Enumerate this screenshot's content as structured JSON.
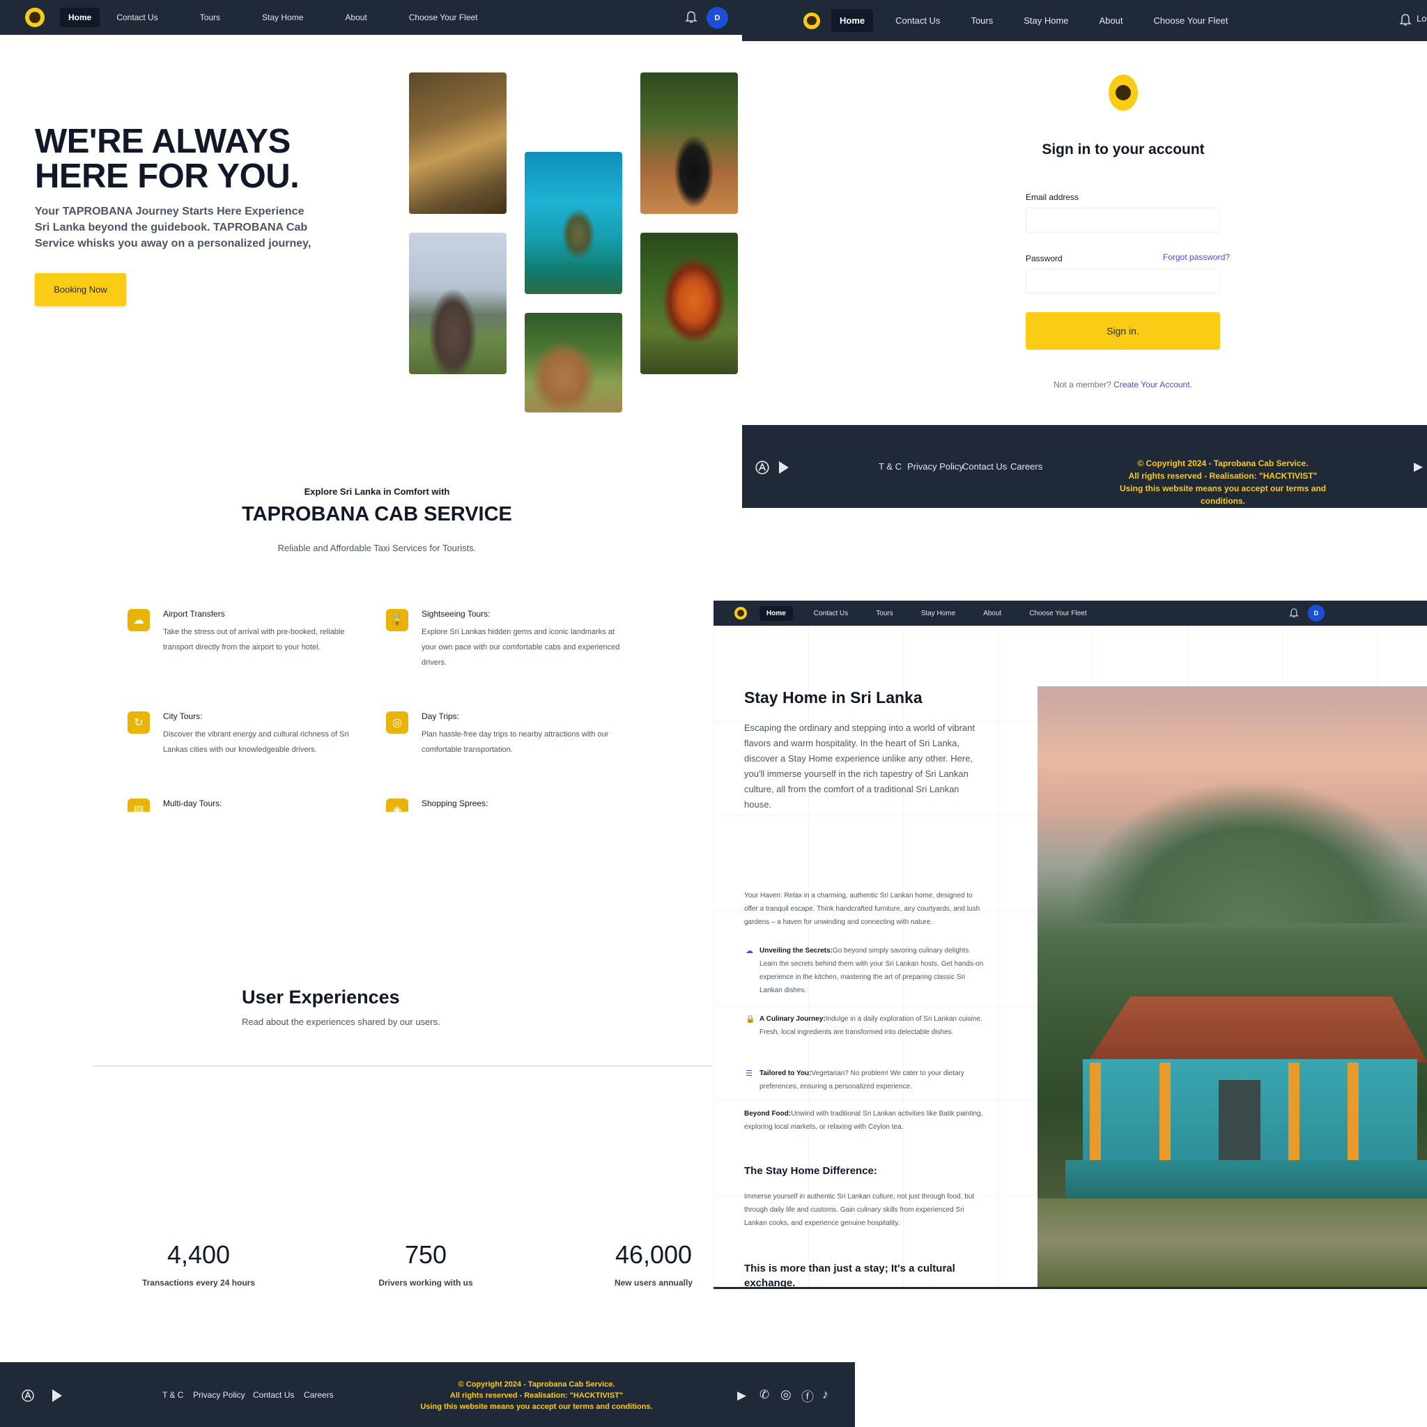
{
  "nav": {
    "items": [
      "Home",
      "Contact Us",
      "Tours",
      "Stay Home",
      "About",
      "Choose Your Fleet"
    ],
    "avatar_letter": "D",
    "login_partial": "Lo"
  },
  "home": {
    "hero_title": "WE'RE ALWAYS HERE FOR YOU.",
    "hero_text": "Your TAPROBANA Journey Starts Here Experience Sri Lanka beyond the guidebook. TAPROBANA Cab Service whisks you away on a personalized journey,",
    "booking_button": "Booking Now",
    "explore_sub": "Explore Sri Lanka in Comfort with",
    "explore_title": "TAPROBANA CAB SERVICE",
    "explore_desc": "Reliable and Affordable Taxi Services for Tourists.",
    "services": [
      {
        "icon": "cloud-upload-icon",
        "title": "Airport Transfers",
        "desc": "Take the stress out of arrival with pre-booked, reliable transport directly from the airport to your hotel."
      },
      {
        "icon": "lock-icon",
        "title": "Sightseeing Tours:",
        "desc": "Explore Sri Lankas hidden gems and iconic landmarks at your own pace with our comfortable cabs and experienced drivers."
      },
      {
        "icon": "refresh-icon",
        "title": "City Tours:",
        "desc": "Discover the vibrant energy and cultural richness of Sri Lankas cities with our knowledgeable drivers."
      },
      {
        "icon": "fingerprint-icon",
        "title": "Day Trips:",
        "desc": "Plan hassle-free day trips to nearby attractions with our comfortable transportation."
      },
      {
        "icon": "map-icon",
        "title": "Multi-day Tours:",
        "desc": ""
      },
      {
        "icon": "bag-icon",
        "title": "Shopping Sprees:",
        "desc": ""
      }
    ],
    "user_exp_title": "User Experiences",
    "user_exp_desc": "Read about the experiences shared by our users.",
    "stats": [
      {
        "value": "4,400",
        "label": "Transactions every 24 hours"
      },
      {
        "value": "750",
        "label": "Drivers working with us"
      },
      {
        "value": "46,000",
        "label": "New users annually"
      }
    ]
  },
  "footer": {
    "links": [
      "T & C",
      "Privacy Policy",
      "Contact Us",
      "Careers"
    ],
    "copyright": "© Copyright 2024 - Taprobana Cab Service.",
    "rights": "All rights reserved - Realisation: \"HACKTIVIST\"",
    "terms": "Using this website means you accept our terms and conditions."
  },
  "signin": {
    "title": "Sign in to your account",
    "email_label": "Email address",
    "password_label": "Password",
    "forgot": "Forgot password?",
    "button": "Sign in.",
    "not_member": "Not a member?",
    "create": "Create Your Account."
  },
  "stayhome": {
    "title": "Stay Home in Sri Lanka",
    "intro": "Escaping the ordinary and stepping into a world of vibrant flavors and warm hospitality. In the heart of Sri Lanka, discover a Stay Home experience unlike any other. Here, you'll immerse yourself in the rich tapestry of Sri Lankan culture, all from the comfort of a traditional Sri Lankan house.",
    "haven": "Your Haven: Relax in a charming, authentic Sri Lankan home, designed to offer a tranquil escape. Think handcrafted furniture, airy courtyards, and lush gardens – a haven for unwinding and connecting with nature.",
    "points": [
      {
        "icon": "cloud-icon",
        "title": "Unveiling the Secrets:",
        "text": "Go beyond simply savoring culinary delights. Learn the secrets behind them with your Sri Lankan hosts. Get hands-on experience in the kitchen, mastering the art of preparing classic Sri Lankan dishes."
      },
      {
        "icon": "lock-icon",
        "title": "A Culinary Journey:",
        "text": "Indulge in a daily exploration of Sri Lankan cuisine. Fresh, local ingredients are transformed into delectable dishes."
      },
      {
        "icon": "server-icon",
        "title": "Tailored to You:",
        "text": "Vegetarian? No problem! We cater to your dietary preferences, ensuring a personalized experience."
      }
    ],
    "beyond_title": "Beyond Food:",
    "beyond_text": "Unwind with traditional Sri Lankan activities like Batik painting, exploring local markets, or relaxing with Ceylon tea.",
    "difference_title": "The Stay Home Difference:",
    "difference_text": "Immerse yourself in authentic Sri Lankan culture, not just through food, but through daily life and customs. Gain culinary skills from experienced Sri Lankan cooks, and experience genuine hospitality.",
    "closing": "This is more than just a stay; It's a cultural exchange."
  },
  "colors": {
    "nav_bg": "#1f2937",
    "accent": "#facc15",
    "link": "#4f46e5",
    "avatar": "#1d4ed8"
  }
}
